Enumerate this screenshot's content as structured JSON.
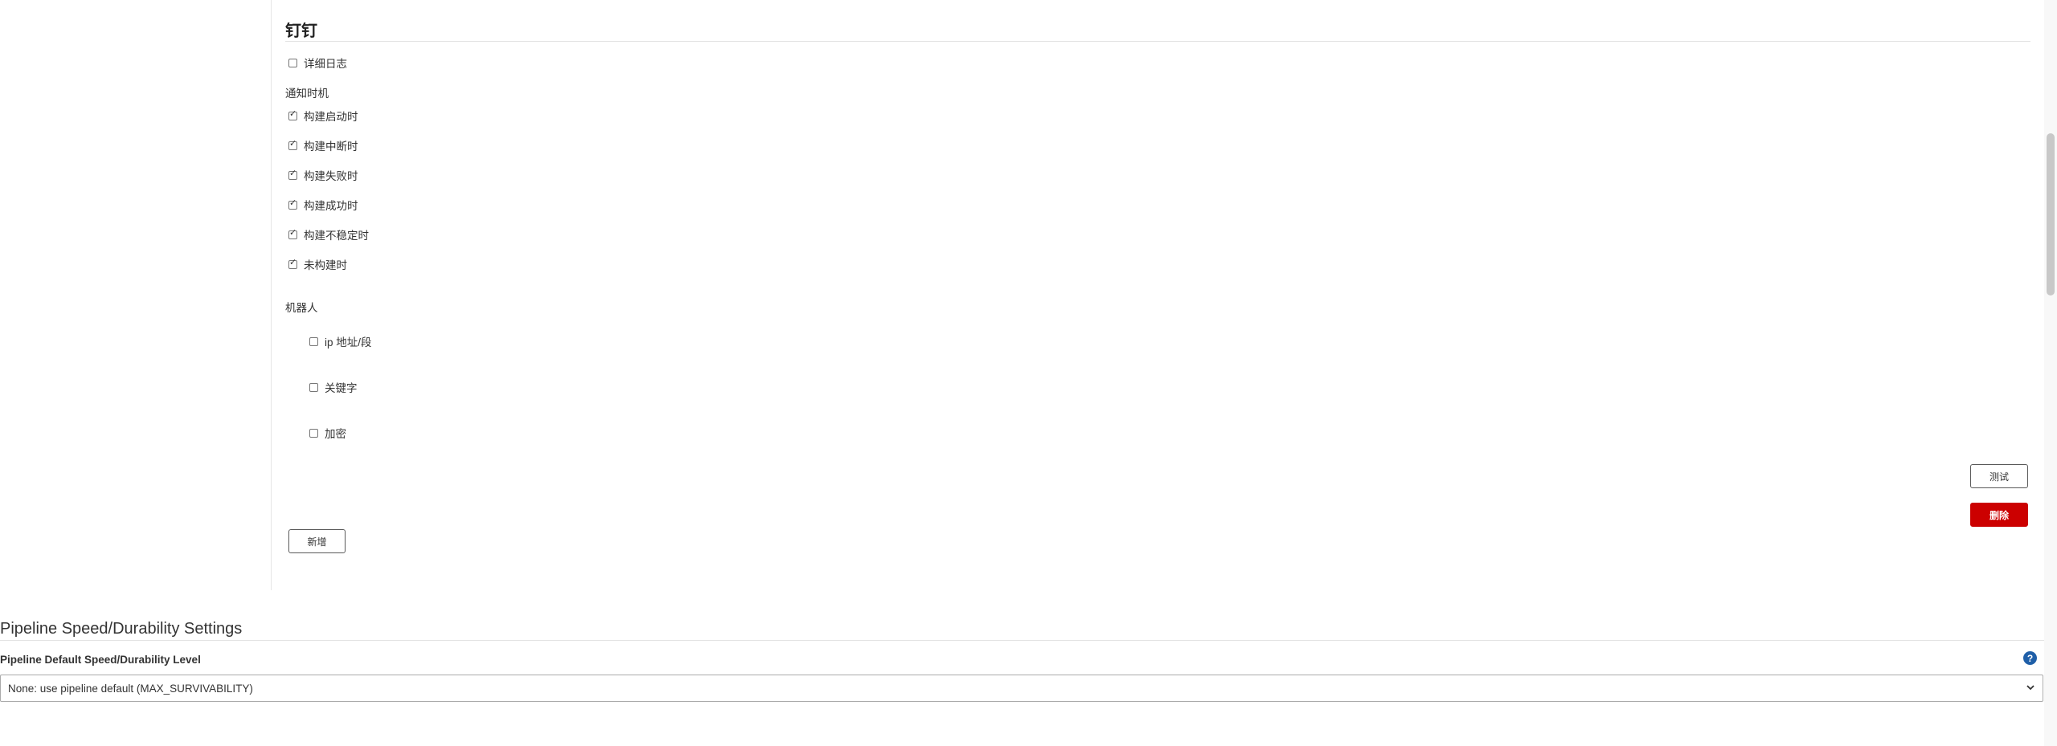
{
  "dingtalk": {
    "title": "钉钉",
    "verbose_log_label": "详细日志",
    "notify_timing_label": "通知时机",
    "notify_options": [
      {
        "label": "构建启动时",
        "checked": true
      },
      {
        "label": "构建中断时",
        "checked": true
      },
      {
        "label": "构建失败时",
        "checked": true
      },
      {
        "label": "构建成功时",
        "checked": true
      },
      {
        "label": "构建不稳定时",
        "checked": true
      },
      {
        "label": "未构建时",
        "checked": true
      }
    ],
    "robot_label": "机器人",
    "robot_options": [
      {
        "label": "ip 地址/段",
        "checked": false
      },
      {
        "label": "关键字",
        "checked": false
      },
      {
        "label": "加密",
        "checked": false
      }
    ],
    "test_button": "测试",
    "delete_button": "删除",
    "add_button": "新增"
  },
  "pipeline": {
    "section_title": "Pipeline Speed/Durability Settings",
    "field_label": "Pipeline Default Speed/Durability Level",
    "help_icon": "?",
    "selected_value": "None: use pipeline default (MAX_SURVIVABILITY)"
  },
  "colors": {
    "danger": "#cc0000",
    "help": "#1f5fa8"
  }
}
